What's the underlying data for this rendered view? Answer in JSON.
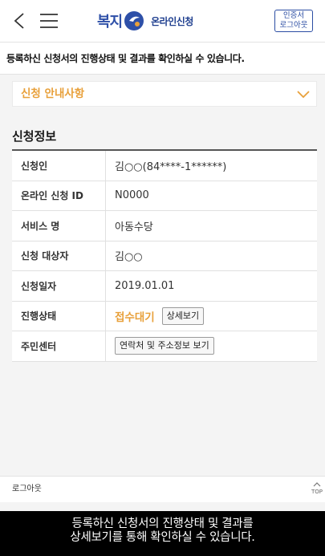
{
  "header": {
    "logo_word": "복지",
    "logo_sub": "온라인신청",
    "cert_logout": [
      "인증서",
      "로그아웃"
    ]
  },
  "notice": "등록하신 신청서의 진행상태 및 결과를 확인하실 수 있습니다.",
  "guide": {
    "title": "신청 안내사항"
  },
  "section_title": "신청정보",
  "rows": [
    {
      "label": "신청인",
      "value": "김○○(84****-1******)"
    },
    {
      "label": "온라인 신청 ID",
      "value": "N0000"
    },
    {
      "label": "서비스 명",
      "value": "아동수당"
    },
    {
      "label": "신청 대상자",
      "value": "김○○"
    },
    {
      "label": "신청일자",
      "value": "2019.01.01"
    },
    {
      "label": "진행상태",
      "value": "접수대기",
      "button": "상세보기"
    },
    {
      "label": "주민센터",
      "button": "연락처 및 주소정보 보기"
    }
  ],
  "footer": {
    "logout": "로그아웃",
    "top": "TOP"
  },
  "caption": [
    "등록하신 신청서의 진행상태 및 결과를",
    "상세보기를 통해 확인하실 수 있습니다."
  ],
  "colors": {
    "brand_blue": "#2e50a8",
    "accent_orange": "#e8a03a"
  }
}
